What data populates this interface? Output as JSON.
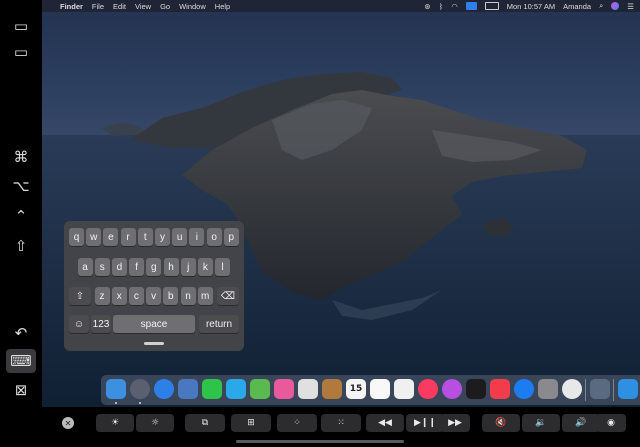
{
  "menubar": {
    "apple": "",
    "items": [
      "Finder",
      "File",
      "Edit",
      "View",
      "Go",
      "Window",
      "Help"
    ],
    "datetime": "Mon 10:57 AM",
    "user": "Amanda"
  },
  "sidebar": {
    "items": [
      {
        "name": "show-menubar-button",
        "glyph": "▭"
      },
      {
        "name": "show-dock-button",
        "glyph": "▭"
      },
      {
        "name": "command-key-button",
        "glyph": "⌘"
      },
      {
        "name": "option-key-button",
        "glyph": "⌥"
      },
      {
        "name": "control-key-button",
        "glyph": "⌃"
      },
      {
        "name": "shift-key-button",
        "glyph": "⇧"
      },
      {
        "name": "undo-button",
        "glyph": "↶"
      },
      {
        "name": "keyboard-toggle-button",
        "glyph": "⌨"
      },
      {
        "name": "disconnect-button",
        "glyph": "⊠"
      }
    ]
  },
  "keyboard": {
    "row1": [
      "q",
      "w",
      "e",
      "r",
      "t",
      "y",
      "u",
      "i",
      "o",
      "p"
    ],
    "row2": [
      "a",
      "s",
      "d",
      "f",
      "g",
      "h",
      "j",
      "k",
      "l"
    ],
    "row3": [
      "z",
      "x",
      "c",
      "v",
      "b",
      "n",
      "m"
    ],
    "shift": "⇧",
    "delete": "⌫",
    "emoji": "☺",
    "numbers": "123",
    "space": "space",
    "return": "return"
  },
  "dock": {
    "colors": [
      "#3d8fe0",
      "#5a6070",
      "#2f7fe8",
      "#4a78c0",
      "#2ec44a",
      "#2aa8e8",
      "#5ab94f",
      "#e85a9c",
      "#e0e0e0",
      "#b07a3f",
      "#f5f5f5",
      "#f8f8f8",
      "#f0f0f0",
      "#fb3a5f",
      "#b84fe0",
      "#1c1c1e",
      "#f23c4a",
      "#1d7cf2",
      "#8a8a8e",
      "#e8e8e8",
      "#5a6a80",
      "#2f8fe0",
      "#8a8f99"
    ],
    "icon_names": [
      "finder-icon",
      "launchpad-icon",
      "safari-icon",
      "mail-icon",
      "facetime-icon",
      "messages-icon",
      "maps-icon",
      "photos-icon",
      "contacts-icon",
      "notes-icon",
      "calendar-icon",
      "reminders-icon",
      "textedit-icon",
      "music-icon",
      "podcasts-icon",
      "apple-tv-icon",
      "news-icon",
      "app-store-icon",
      "system-preferences-icon",
      "chrome-icon",
      "preview-icon",
      "downloads-folder-icon",
      "trash-icon"
    ],
    "calendar_day": "15"
  },
  "touchbar": {
    "close": "✕",
    "buttons": [
      {
        "name": "brightness-down-button",
        "glyph": "☀"
      },
      {
        "name": "brightness-up-button",
        "glyph": "☼"
      },
      {
        "name": "mission-control-button",
        "glyph": "⧉"
      },
      {
        "name": "launchpad-button",
        "glyph": "⊞"
      },
      {
        "name": "keyboard-light-down-button",
        "glyph": "⁘"
      },
      {
        "name": "keyboard-light-up-button",
        "glyph": "⁙"
      },
      {
        "name": "rewind-button",
        "glyph": "◀◀"
      },
      {
        "name": "play-pause-button",
        "glyph": "▶❙❙"
      },
      {
        "name": "fast-forward-button",
        "glyph": "▶▶"
      },
      {
        "name": "mute-button",
        "glyph": "🔇"
      },
      {
        "name": "volume-down-button",
        "glyph": "🔉"
      },
      {
        "name": "volume-up-button",
        "glyph": "🔊"
      },
      {
        "name": "siri-button",
        "glyph": "◉"
      }
    ]
  }
}
